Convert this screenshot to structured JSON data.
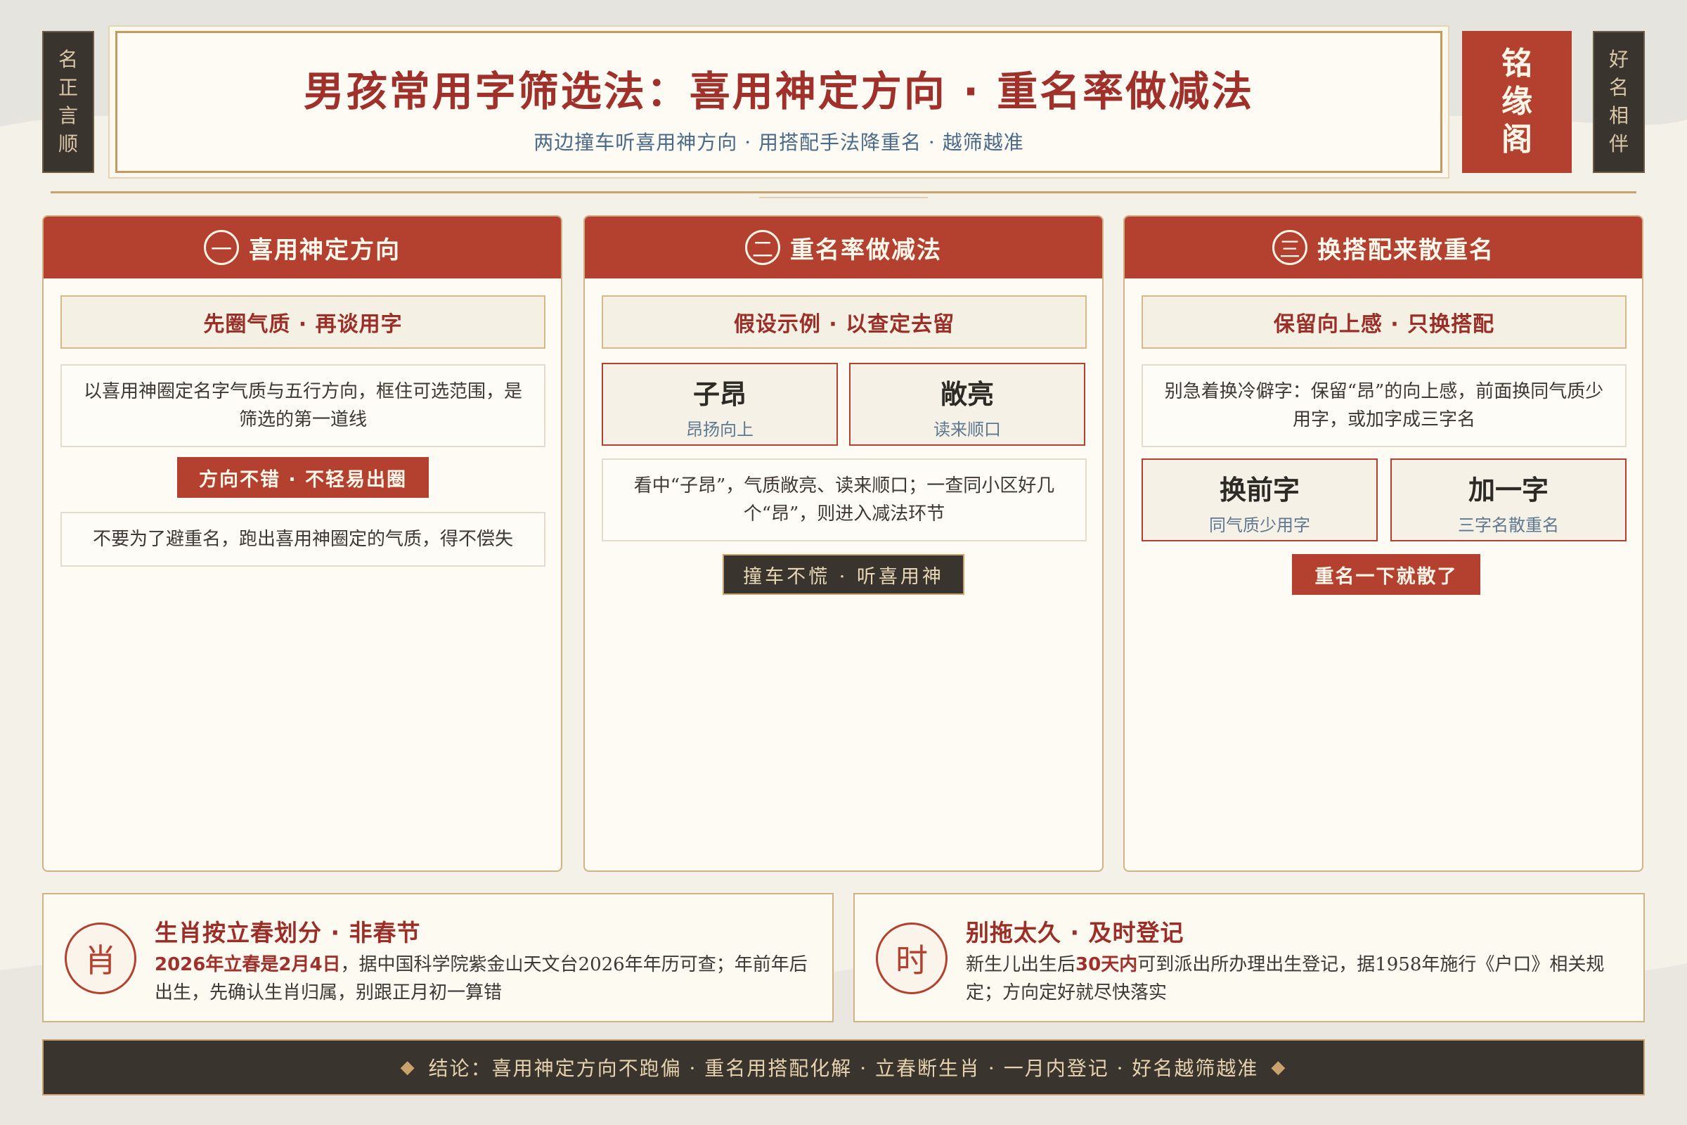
{
  "header": {
    "left_seal": [
      "名",
      "正",
      "言",
      "顺"
    ],
    "right_seal": [
      "好",
      "名",
      "相",
      "伴"
    ],
    "title": "男孩常用字筛选法：喜用神定方向 · 重名率做减法",
    "subtitle": "两边撞车听喜用神方向 · 用搭配手法降重名 · 越筛越准",
    "brand": [
      "铭",
      "缘",
      "阁"
    ]
  },
  "columns": [
    {
      "num": "一",
      "title": "喜用神定方向",
      "box_title": "先圈气质 · 再谈用字",
      "text1": "以喜用神圈定名字气质与五行方向，框住可选范围，是筛选的第一道线",
      "tag": "方向不错 · 不轻易出圈",
      "text2": "不要为了避重名，跑出喜用神圈定的气质，得不偿失"
    },
    {
      "num": "二",
      "title": "重名率做减法",
      "box_title": "假设示例 · 以查定去留",
      "pairs": [
        {
          "main": "子昂",
          "sub": "昂扬向上"
        },
        {
          "main": "敞亮",
          "sub": "读来顺口"
        }
      ],
      "text1": "看中“子昂”，气质敞亮、读来顺口；一查同小区好几个“昂”，则进入减法环节",
      "tag": "撞车不慌 · 听喜用神"
    },
    {
      "num": "三",
      "title": "换搭配来散重名",
      "box_title": "保留向上感 · 只换搭配",
      "text1": "别急着换冷僻字：保留“昂”的向上感，前面换同气质少用字，或加字成三字名",
      "pairs": [
        {
          "main": "换前字",
          "sub": "同气质少用字"
        },
        {
          "main": "加一字",
          "sub": "三字名散重名"
        }
      ],
      "tag": "重名一下就散了"
    }
  ],
  "cards": [
    {
      "icon": "肖",
      "title": "生肖按立春划分 · 非春节",
      "highlight": "2026年立春是2月4日",
      "text": "，据中国科学院紫金山天文台2026年年历可查；年前年后出生，先确认生肖归属，别跟正月初一算错"
    },
    {
      "icon": "时",
      "title": "别拖太久 · 及时登记",
      "text_before": "新生儿出生后",
      "highlight": "30天内",
      "text_after": "可到派出所办理出生登记，据1958年施行《户口》相关规定；方向定好就尽快落实"
    },
    {}
  ],
  "footer": {
    "left_mark": "◆",
    "text": "结论：喜用神定方向不跑偏 · 重名用搭配化解 · 立春断生肖 · 一月内登记 · 好名越筛越准",
    "right_mark": "◆"
  },
  "colors": {
    "accent_red": "#b4412f",
    "gold": "#c9a36b",
    "dark": "#3a342e",
    "paper": "#fdfbf3"
  }
}
